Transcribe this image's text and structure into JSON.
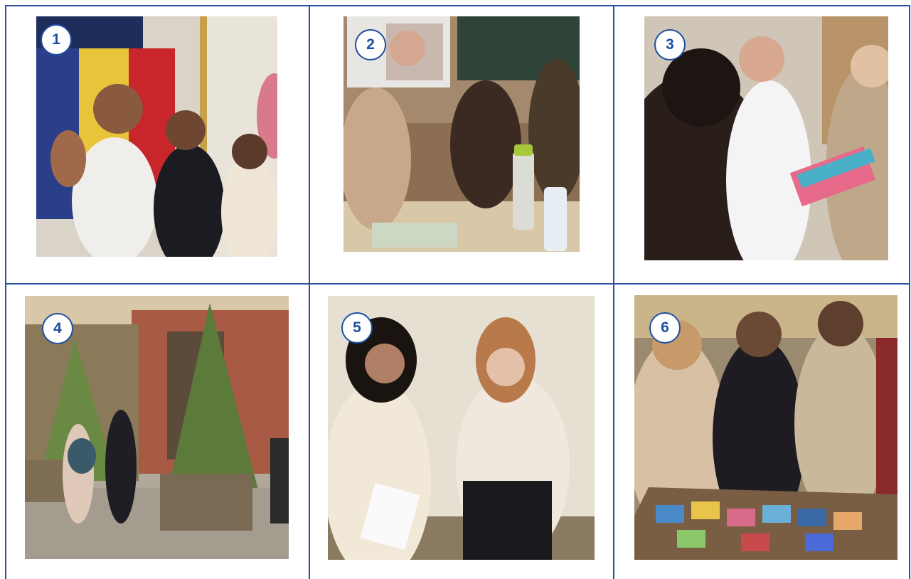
{
  "photos": [
    {
      "number": "1"
    },
    {
      "number": "2"
    },
    {
      "number": "3"
    },
    {
      "number": "4"
    },
    {
      "number": "5"
    },
    {
      "number": "6"
    }
  ],
  "colors": {
    "grid_line": "#2f4f9f",
    "badge_text": "#1d4ea3",
    "badge_fill": "#ffffff"
  }
}
